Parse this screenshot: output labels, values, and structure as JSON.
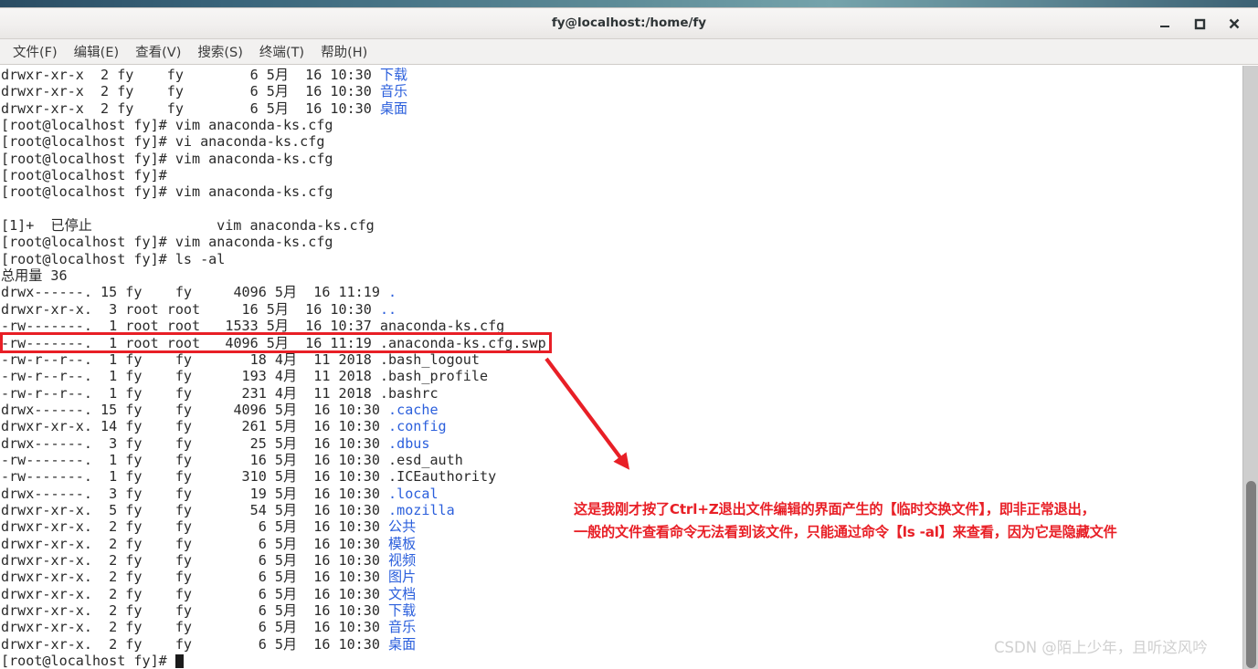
{
  "window": {
    "title": "fy@localhost:/home/fy",
    "controls": [
      {
        "name": "minimize-button",
        "glyph": "minimize"
      },
      {
        "name": "maximize-button",
        "glyph": "maximize"
      },
      {
        "name": "close-button",
        "glyph": "close"
      }
    ]
  },
  "menubar": {
    "items": [
      {
        "label": "文件(F)"
      },
      {
        "label": "编辑(E)"
      },
      {
        "label": "查看(V)"
      },
      {
        "label": "搜索(S)"
      },
      {
        "label": "终端(T)"
      },
      {
        "label": "帮助(H)"
      }
    ]
  },
  "terminal": {
    "prompt": "[root@localhost fy]# ",
    "lines": [
      {
        "text": "drwxr-xr-x  2 fy    fy        6 5月  16 10:30 ",
        "suffix": "下载",
        "suffix_color": "blue"
      },
      {
        "text": "drwxr-xr-x  2 fy    fy        6 5月  16 10:30 ",
        "suffix": "音乐",
        "suffix_color": "blue"
      },
      {
        "text": "drwxr-xr-x  2 fy    fy        6 5月  16 10:30 ",
        "suffix": "桌面",
        "suffix_color": "blue"
      },
      {
        "text": "[root@localhost fy]# vim anaconda-ks.cfg",
        "suffix": "",
        "suffix_color": ""
      },
      {
        "text": "[root@localhost fy]# vi anaconda-ks.cfg",
        "suffix": "",
        "suffix_color": ""
      },
      {
        "text": "[root@localhost fy]# vim anaconda-ks.cfg",
        "suffix": "",
        "suffix_color": ""
      },
      {
        "text": "[root@localhost fy]# ",
        "suffix": "",
        "suffix_color": ""
      },
      {
        "text": "[root@localhost fy]# vim anaconda-ks.cfg",
        "suffix": "",
        "suffix_color": ""
      },
      {
        "text": "",
        "suffix": "",
        "suffix_color": ""
      },
      {
        "text": "[1]+  已停止               vim anaconda-ks.cfg",
        "suffix": "",
        "suffix_color": ""
      },
      {
        "text": "[root@localhost fy]# vim anaconda-ks.cfg",
        "suffix": "",
        "suffix_color": ""
      },
      {
        "text": "[root@localhost fy]# ls -al",
        "suffix": "",
        "suffix_color": ""
      },
      {
        "text": "总用量 36",
        "suffix": "",
        "suffix_color": ""
      },
      {
        "text": "drwx------. 15 fy    fy     4096 5月  16 11:19 ",
        "suffix": ".",
        "suffix_color": "blue"
      },
      {
        "text": "drwxr-xr-x.  3 root root     16 5月  16 10:30 ",
        "suffix": "..",
        "suffix_color": "blue"
      },
      {
        "text": "-rw-------.  1 root root   1533 5月  16 10:37 anaconda-ks.cfg",
        "suffix": "",
        "suffix_color": ""
      },
      {
        "text": "-rw-------.  1 root root   4096 5月  16 11:19 .anaconda-ks.cfg.swp",
        "suffix": "",
        "suffix_color": ""
      },
      {
        "text": "-rw-r--r--.  1 fy    fy       18 4月  11 2018 .bash_logout",
        "suffix": "",
        "suffix_color": ""
      },
      {
        "text": "-rw-r--r--.  1 fy    fy      193 4月  11 2018 .bash_profile",
        "suffix": "",
        "suffix_color": ""
      },
      {
        "text": "-rw-r--r--.  1 fy    fy      231 4月  11 2018 .bashrc",
        "suffix": "",
        "suffix_color": ""
      },
      {
        "text": "drwx------. 15 fy    fy     4096 5月  16 10:30 ",
        "suffix": ".cache",
        "suffix_color": "blue"
      },
      {
        "text": "drwxr-xr-x. 14 fy    fy      261 5月  16 10:30 ",
        "suffix": ".config",
        "suffix_color": "blue"
      },
      {
        "text": "drwx------.  3 fy    fy       25 5月  16 10:30 ",
        "suffix": ".dbus",
        "suffix_color": "blue"
      },
      {
        "text": "-rw-------.  1 fy    fy       16 5月  16 10:30 .esd_auth",
        "suffix": "",
        "suffix_color": ""
      },
      {
        "text": "-rw-------.  1 fy    fy      310 5月  16 10:30 .ICEauthority",
        "suffix": "",
        "suffix_color": ""
      },
      {
        "text": "drwx------.  3 fy    fy       19 5月  16 10:30 ",
        "suffix": ".local",
        "suffix_color": "blue"
      },
      {
        "text": "drwxr-xr-x.  5 fy    fy       54 5月  16 10:30 ",
        "suffix": ".mozilla",
        "suffix_color": "blue"
      },
      {
        "text": "drwxr-xr-x.  2 fy    fy        6 5月  16 10:30 ",
        "suffix": "公共",
        "suffix_color": "blue"
      },
      {
        "text": "drwxr-xr-x.  2 fy    fy        6 5月  16 10:30 ",
        "suffix": "模板",
        "suffix_color": "blue"
      },
      {
        "text": "drwxr-xr-x.  2 fy    fy        6 5月  16 10:30 ",
        "suffix": "视频",
        "suffix_color": "blue"
      },
      {
        "text": "drwxr-xr-x.  2 fy    fy        6 5月  16 10:30 ",
        "suffix": "图片",
        "suffix_color": "blue"
      },
      {
        "text": "drwxr-xr-x.  2 fy    fy        6 5月  16 10:30 ",
        "suffix": "文档",
        "suffix_color": "blue"
      },
      {
        "text": "drwxr-xr-x.  2 fy    fy        6 5月  16 10:30 ",
        "suffix": "下载",
        "suffix_color": "blue"
      },
      {
        "text": "drwxr-xr-x.  2 fy    fy        6 5月  16 10:30 ",
        "suffix": "音乐",
        "suffix_color": "blue"
      },
      {
        "text": "drwxr-xr-x.  2 fy    fy        6 5月  16 10:30 ",
        "suffix": "桌面",
        "suffix_color": "blue"
      }
    ],
    "last_prompt": "[root@localhost fy]# "
  },
  "annotation": {
    "highlight_line": "-rw-------.  1 root root   4096 5月  16 11:19 .anaconda-ks.cfg.swp",
    "line1": "这是我刚才按了Ctrl+Z退出文件编辑的界面产生的【临时交换文件】，即非正常退出，",
    "line2": "一般的文件查看命令无法看到该文件，只能通过命令【ls -al】来查看，因为它是隐藏文件",
    "color": "#e81f26"
  },
  "watermark": {
    "text": "CSDN @陌上少年，且听这风吟"
  }
}
